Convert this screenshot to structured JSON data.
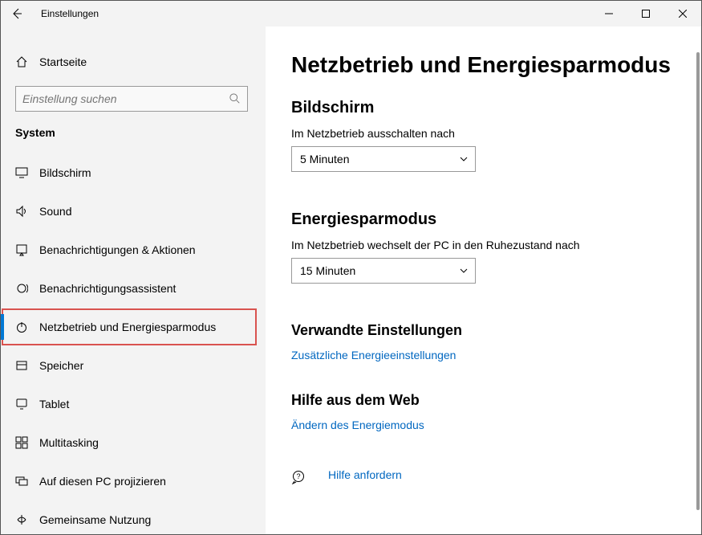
{
  "window": {
    "title": "Einstellungen"
  },
  "sidebar": {
    "home": "Startseite",
    "search_placeholder": "Einstellung suchen",
    "section": "System",
    "items": [
      {
        "label": "Bildschirm",
        "icon": "display"
      },
      {
        "label": "Sound",
        "icon": "sound"
      },
      {
        "label": "Benachrichtigungen & Aktionen",
        "icon": "notifications"
      },
      {
        "label": "Benachrichtigungsassistent",
        "icon": "focus"
      },
      {
        "label": "Netzbetrieb und Energiesparmodus",
        "icon": "power",
        "active": true,
        "highlighted": true
      },
      {
        "label": "Speicher",
        "icon": "storage"
      },
      {
        "label": "Tablet",
        "icon": "tablet"
      },
      {
        "label": "Multitasking",
        "icon": "multitask"
      },
      {
        "label": "Auf diesen PC projizieren",
        "icon": "project"
      },
      {
        "label": "Gemeinsame Nutzung",
        "icon": "share"
      }
    ]
  },
  "content": {
    "title": "Netzbetrieb und Energiesparmodus",
    "screen": {
      "heading": "Bildschirm",
      "label": "Im Netzbetrieb ausschalten nach",
      "value": "5 Minuten"
    },
    "sleep": {
      "heading": "Energiesparmodus",
      "label": "Im Netzbetrieb wechselt der PC in den Ruhezustand nach",
      "value": "15 Minuten"
    },
    "related": {
      "heading": "Verwandte Einstellungen",
      "link": "Zusätzliche Energieeinstellungen"
    },
    "webhelp": {
      "heading": "Hilfe aus dem Web",
      "link": "Ändern des Energiemodus"
    },
    "gethelp": "Hilfe anfordern"
  }
}
